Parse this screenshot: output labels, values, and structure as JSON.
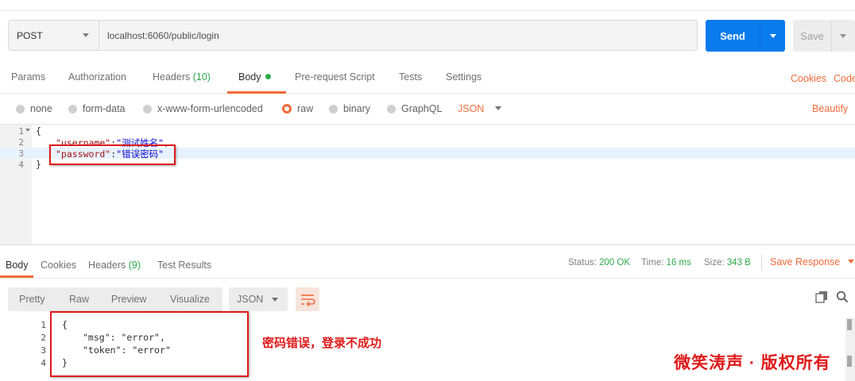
{
  "request": {
    "method": "POST",
    "url": "localhost:6060/public/login",
    "send_label": "Send",
    "save_label": "Save"
  },
  "req_tabs": {
    "params": "Params",
    "authorization": "Authorization",
    "headers": "Headers",
    "headers_count": "(10)",
    "body": "Body",
    "pre_request": "Pre-request Script",
    "tests": "Tests",
    "settings": "Settings",
    "cookies": "Cookies",
    "code": "Code"
  },
  "body_types": {
    "none": "none",
    "form_data": "form-data",
    "urlencoded": "x-www-form-urlencoded",
    "raw": "raw",
    "binary": "binary",
    "graphql": "GraphQL",
    "format": "JSON",
    "beautify": "Beautify"
  },
  "request_body": {
    "line_numbers": [
      "1",
      "2",
      "3",
      "4"
    ],
    "open": "{",
    "close": "}",
    "username_key": "\"username\"",
    "username_value": "\"测试姓名\"",
    "password_key": "\"password\"",
    "password_value": "\"错误密码\""
  },
  "response_tabs": {
    "body": "Body",
    "cookies": "Cookies",
    "headers": "Headers",
    "headers_count": "(9)",
    "test_results": "Test Results"
  },
  "response_status": {
    "status_label": "Status:",
    "status_value": "200 OK",
    "time_label": "Time:",
    "time_value": "16 ms",
    "size_label": "Size:",
    "size_value": "343 B",
    "save_response": "Save Response"
  },
  "response_view": {
    "pretty": "Pretty",
    "raw": "Raw",
    "preview": "Preview",
    "visualize": "Visualize",
    "format": "JSON"
  },
  "response_body": {
    "line_numbers": [
      "1",
      "2",
      "3",
      "4"
    ],
    "open": "{",
    "close": "}",
    "msg_key": "\"msg\"",
    "msg_value": "\"error\"",
    "token_key": "\"token\"",
    "token_value": "\"error\""
  },
  "annotation": "密码错误，登录不成功",
  "watermark": "微笑涛声 · 版权所有",
  "colors": {
    "accent": "#f26b3a",
    "send_blue": "#097bed",
    "status_green": "#2eaa4a",
    "annotation_red": "#e01919"
  }
}
